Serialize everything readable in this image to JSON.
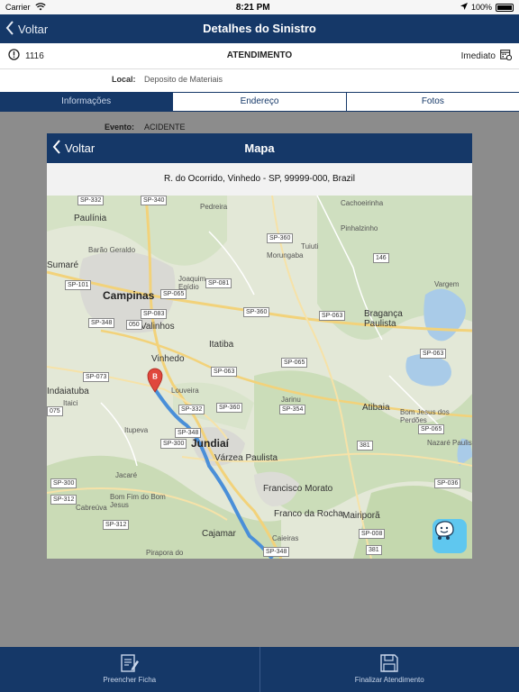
{
  "statusbar": {
    "carrier": "Carrier",
    "time": "8:21 PM",
    "battery": "100%"
  },
  "navbar": {
    "back_label": "Voltar",
    "title": "Detalhes do Sinistro"
  },
  "claim": {
    "number": "1116",
    "status": "ATENDIMENTO",
    "urgency": "Imediato"
  },
  "local": {
    "label": "Local:",
    "value": "Deposito de Materiais"
  },
  "tabs": [
    {
      "label": "Informações",
      "active": true
    },
    {
      "label": "Endereço",
      "active": false
    },
    {
      "label": "Fotos",
      "active": false
    }
  ],
  "event": {
    "label": "Evento:",
    "value": "ACIDENTE"
  },
  "modal": {
    "back_label": "Voltar",
    "title": "Mapa",
    "address": "R. do Ocorrido, Vinhedo - SP, 99999-000, Brazil"
  },
  "map": {
    "marker_label": "B",
    "cities": [
      "Campinas",
      "Paulínia",
      "Valinhos",
      "Vinhedo",
      "Itatiba",
      "Louveira",
      "Jundiaí",
      "Várzea Paulista",
      "Francisco Morato",
      "Franco da Rocha",
      "Cajamar",
      "Caieiras",
      "Mairiporã",
      "Atibaia",
      "Bom Jesus dos Perdões",
      "Nazaré Paulista",
      "Bragança Paulista",
      "Morungaba",
      "Jarinu",
      "Itupeva",
      "Jacaré",
      "Cabreúva",
      "Bom Fim do Bom Jesus",
      "Indaiatuba",
      "Itaici",
      "Joaquim Egídio",
      "Pedreira",
      "Tuiuti",
      "Pinhalzinho",
      "Cachoeirinha",
      "Vargem",
      "Sumaré",
      "Barão Geraldo",
      "Pirapora do"
    ],
    "shields": [
      "SP-332",
      "SP-340",
      "SP-360",
      "SP-101",
      "SP-065",
      "SP-081",
      "SP-083",
      "SP-348",
      "050",
      "SP-073",
      "SP-063",
      "SP-360",
      "SP-354",
      "SP-332",
      "SP-348",
      "SP-300",
      "SP-065",
      "381",
      "SP-036",
      "SP-008",
      "381",
      "SP-300",
      "SP-312",
      "SP-312",
      "SP-063",
      "146",
      "SP-063",
      "SP-065",
      "075",
      "SP-348",
      "SP-360"
    ]
  },
  "bottombar": {
    "fill_label": "Preencher Ficha",
    "finish_label": "Finalizar Atendimento"
  },
  "colors": {
    "primary": "#153868",
    "map_land": "#dfe6d3",
    "route": "#4a8fd8",
    "marker": "#e0473c"
  }
}
